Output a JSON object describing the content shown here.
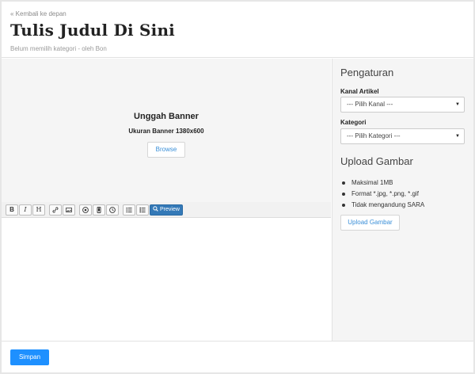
{
  "header": {
    "back_link": "« Kembali ke depan",
    "title": "Tulis Judul Di Sini",
    "meta": "Belum memilih kategori - oleh Bon"
  },
  "banner": {
    "title": "Unggah Banner",
    "size": "Ukuran Banner 1380x600",
    "browse_label": "Browse"
  },
  "toolbar": {
    "bold": "B",
    "italic": "I",
    "heading": "H",
    "icons": [
      "link-icon",
      "image-icon",
      "video-icon",
      "mobile-icon",
      "clock-icon",
      "bullet-list-icon",
      "numbered-list-icon"
    ],
    "preview_label": "Preview"
  },
  "sidebar": {
    "settings_title": "Pengaturan",
    "channel_label": "Kanal Artikel",
    "channel_value": "--- Pilih Kanal ---",
    "category_label": "Kategori",
    "category_value": "--- Pilih Kategori ---",
    "upload_title": "Upload Gambar",
    "rules": [
      "Maksimal 1MB",
      "Format *.jpg, *.png, *.gif",
      "Tidak mengandung SARA"
    ],
    "upload_label": "Upload Gambar"
  },
  "footer": {
    "save_label": "Simpan"
  },
  "colors": {
    "accent": "#1e90ff",
    "preview": "#3479b7",
    "link": "#3a8fd8"
  }
}
